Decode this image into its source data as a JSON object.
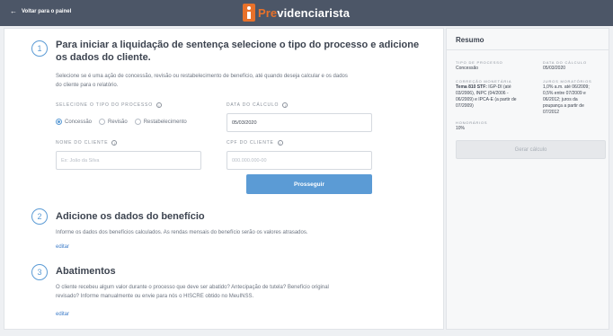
{
  "header": {
    "back_label": "Voltar para o painel",
    "logo_text_accent": "Pre",
    "logo_text_rest": "videnciarista"
  },
  "step1": {
    "number": "1",
    "title_line1": "Para iniciar a liquidação de sentença selecione o tipo do processo e adicione",
    "title_line2": "os dados do cliente.",
    "desc_line1": "Selecione se é uma ação de concessão, revisão ou restabelecimento de benefício, até quando deseja calcular e os dados",
    "desc_line2": "do cliente para o relatório.",
    "tipo_label": "Selecione o tipo do processo",
    "options": [
      "Concessão",
      "Revisão",
      "Restabelecimento"
    ],
    "selected_option": "Concessão",
    "data_label": "Data do cálculo",
    "data_value": "05/03/2020",
    "nome_label": "Nome do cliente",
    "nome_placeholder": "Ex: João da Silva",
    "cpf_label": "CPF do cliente",
    "cpf_placeholder": "000.000.000-00",
    "submit_label": "Prosseguir"
  },
  "step2": {
    "number": "2",
    "title": "Adicione os dados do benefício",
    "desc": "Informe os dados dos benefícios calculados. As rendas mensais do benefício serão os valores atrasados.",
    "edit_label": "editar"
  },
  "step3": {
    "number": "3",
    "title": "Abatimentos",
    "desc_line1": "O cliente recebeu algum valor durante o processo que deve ser abatido? Antecipação de tutela? Benefício original",
    "desc_line2": "revisado? Informe manualmente ou envie para nós o HISCRE obtido no MeuINSS.",
    "edit_label": "editar"
  },
  "summary": {
    "title": "Resumo",
    "tipo_label": "Tipo de processo",
    "tipo_value": "Concessão",
    "data_label": "Data do cálculo",
    "data_value": "05/03/2020",
    "correcao_label": "Correção monetária",
    "correcao_bold": "Tema 810 STF:",
    "correcao_lines": [
      " IGP-DI (até",
      "03/2006), INPC (04/2006 -",
      "06/2009) e IPCA-E (a partir de",
      "07/2009)"
    ],
    "juros_label": "Juros moratórios",
    "juros_lines": [
      "1,0% a.m. até 06/2009;",
      "0,5% entre 07/2009 e",
      "06/2012; juros da",
      "poupança a partir de",
      "07/2012"
    ],
    "honorarios_label": "Honorários",
    "honorarios_value": "10%",
    "generate_label": "Gerar cálculo"
  },
  "colors": {
    "topbar": "#4c5667",
    "accent": "#5b9bd5",
    "brand_orange": "#e8712a"
  }
}
